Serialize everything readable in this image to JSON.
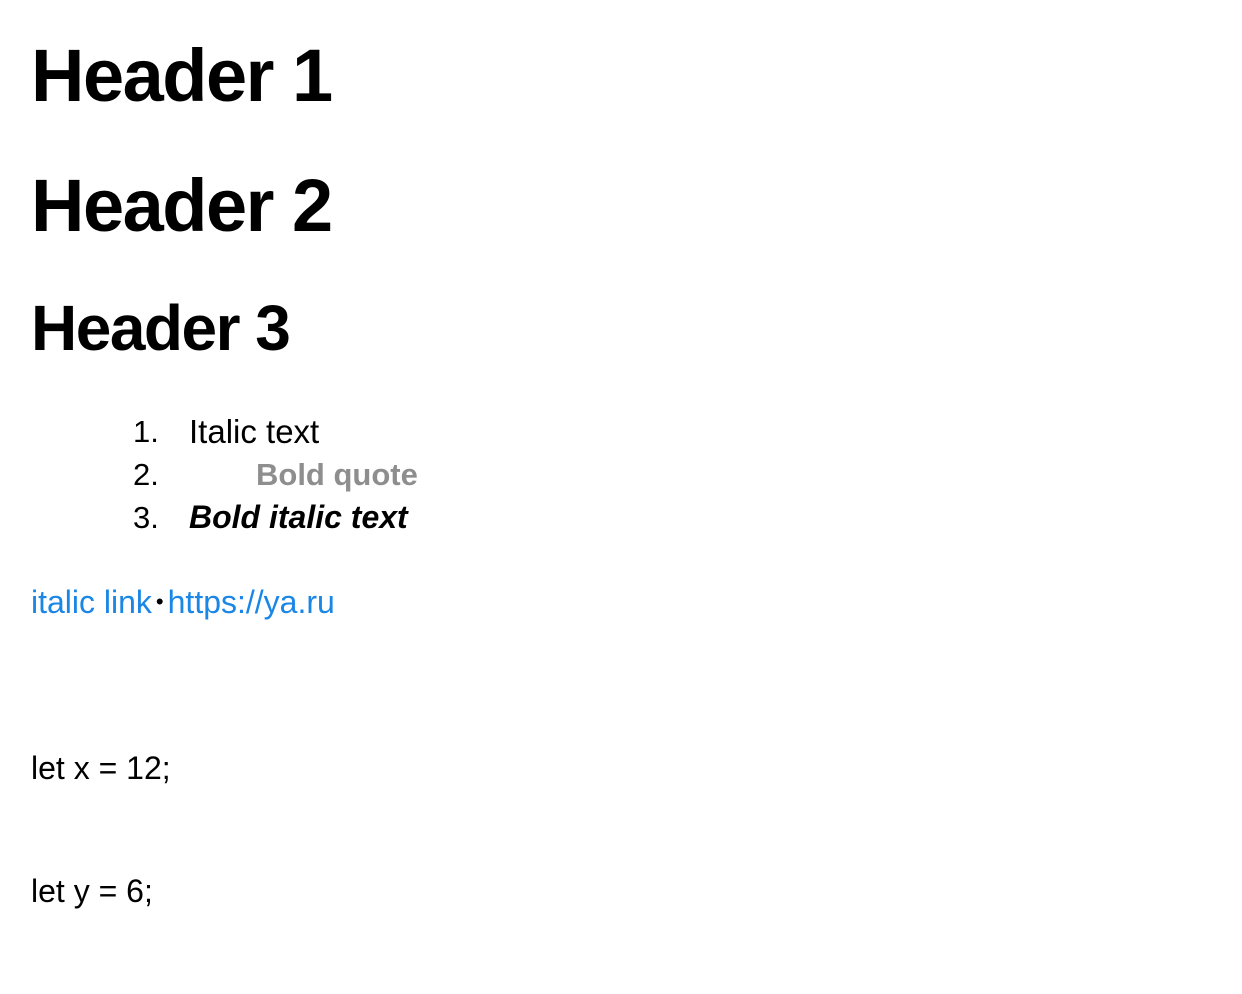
{
  "headers": {
    "h1": "Header 1",
    "h2": "Header 2",
    "h3": "Header 3"
  },
  "list": [
    {
      "number": "1.",
      "text": "Italic text"
    },
    {
      "number": "2.",
      "text": "Bold quote"
    },
    {
      "number": "3.",
      "text": "Bold italic text"
    }
  ],
  "links": {
    "first": "italic link",
    "separator": "•",
    "second": "https://ya.ru"
  },
  "code": {
    "line1": "let x = 12;",
    "line2": "let y = 6;"
  },
  "colors": {
    "link": "#1a86e5",
    "quote": "#8e8e8e",
    "text": "#000000"
  }
}
